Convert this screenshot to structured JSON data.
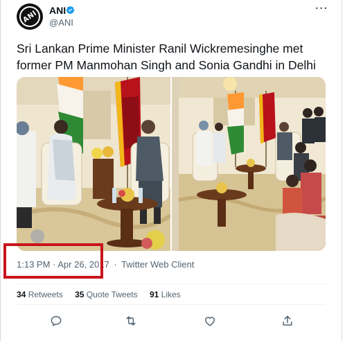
{
  "author": {
    "display_name": "ANI",
    "handle": "@ANI",
    "avatar_text": "ANI",
    "verified": true
  },
  "tweet": {
    "text": "Sri Lankan Prime Minister Ranil Wickremesinghe met former PM Manmohan Singh and Sonia Gandhi in Delhi"
  },
  "meta": {
    "timestamp": "1:13 PM · Apr 26, 2017",
    "separator": "·",
    "source": "Twitter Web Client"
  },
  "stats": {
    "retweets_count": "34",
    "retweets_label": "Retweets",
    "quotes_count": "35",
    "quotes_label": "Quote Tweets",
    "likes_count": "91",
    "likes_label": "Likes"
  },
  "icons": {
    "more": "more-dots-icon",
    "verified": "verified-badge-icon",
    "reply": "reply-icon",
    "retweet": "retweet-icon",
    "like": "like-icon",
    "share": "share-icon"
  },
  "colors": {
    "accent": "#1d9bf0",
    "text": "#0f1419",
    "secondary": "#536471",
    "highlight": "#c8151b"
  }
}
